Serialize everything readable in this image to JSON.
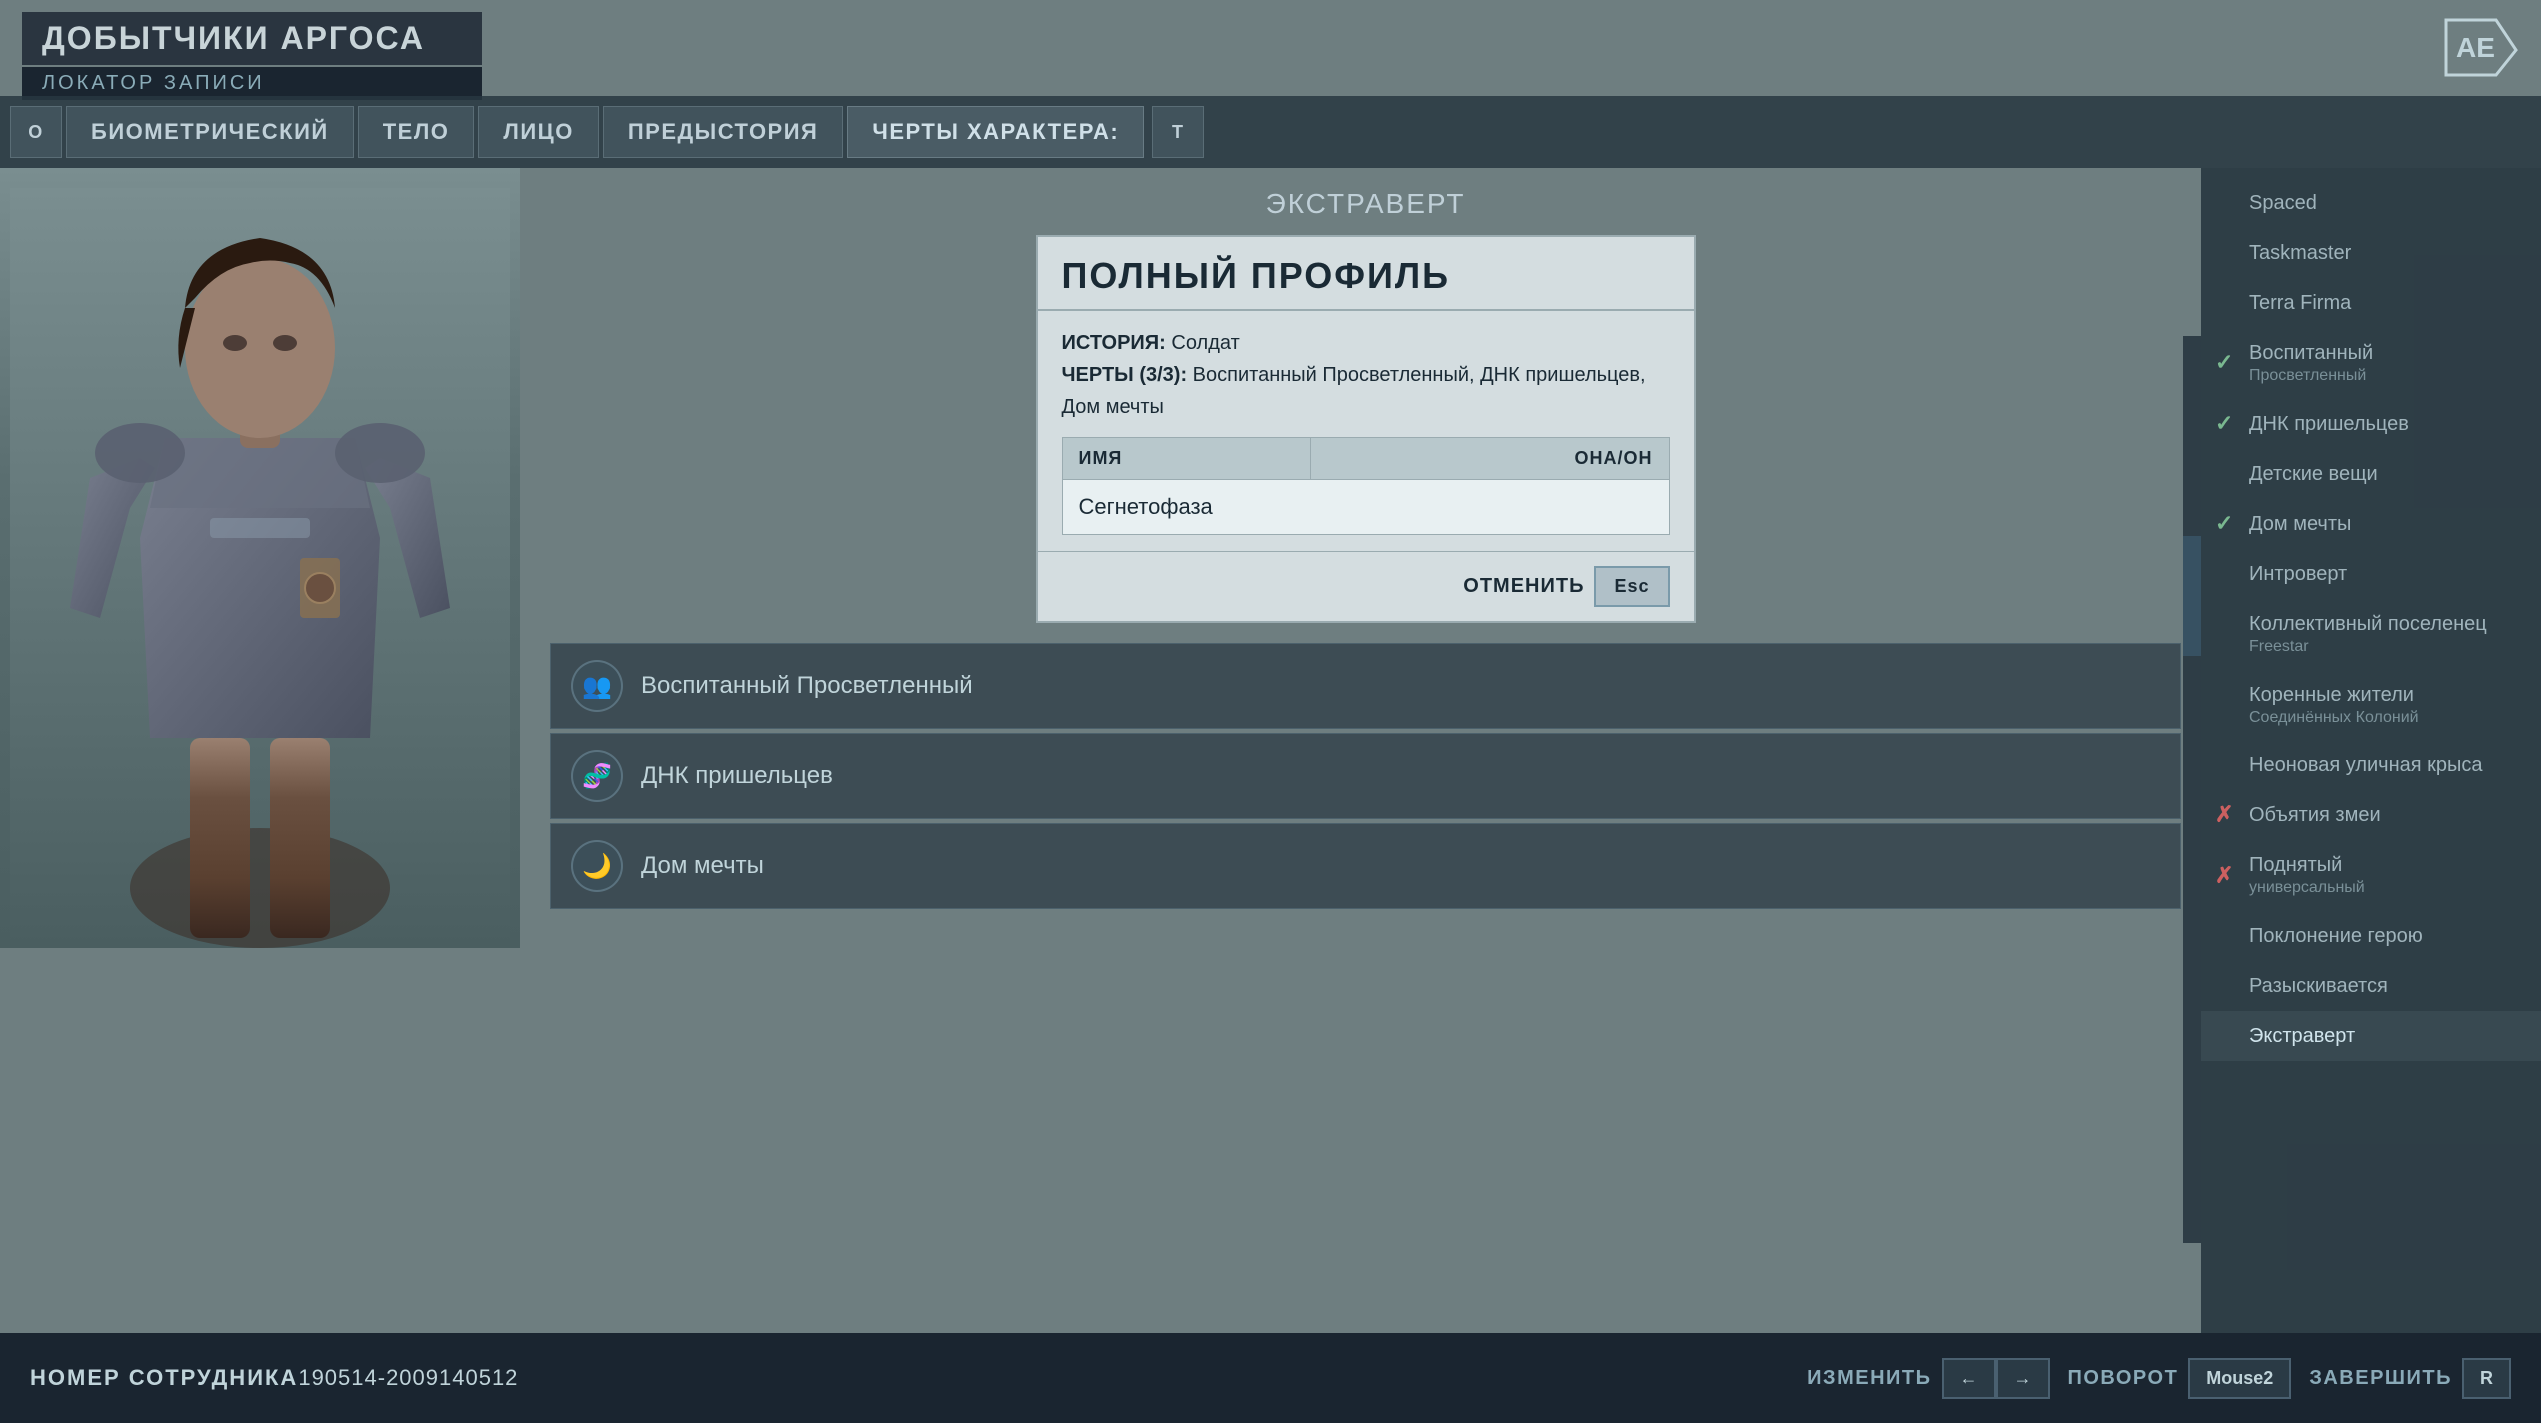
{
  "header": {
    "game_title": "ДОБЫТЧИКИ АРГОСА",
    "subtitle": "ЛОКАТОР ЗАПИСИ",
    "logo_symbol": "AE"
  },
  "nav": {
    "btn_o": "O",
    "btn_biometric": "БИОМЕТРИЧЕСКИЙ",
    "btn_body": "ТЕЛО",
    "btn_face": "ЛИЦО",
    "btn_background": "ПРЕДЫСТОРИЯ",
    "btn_traits": "ЧЕРТЫ ХАРАКТЕРА:",
    "btn_t": "T"
  },
  "character_label": "Экстраверт",
  "profile_modal": {
    "title": "ПОЛНЫЙ ПРОФИЛЬ",
    "history_label": "ИСТОРИЯ:",
    "history_value": "Солдат",
    "traits_label": "ЧЕРТЫ (3/3):",
    "traits_value": "Воспитанный Просветленный, ДНК пришельцев, Дом мечты",
    "table": {
      "col_name": "ИМЯ",
      "col_pronoun": "ОНА/ОН",
      "name_value": "Сегнетофаза"
    },
    "cancel_label": "ОТМЕНИТЬ",
    "esc_label": "Esc"
  },
  "traits_list": [
    {
      "icon": "👥",
      "label": "Воспитанный Просветленный"
    },
    {
      "icon": "🧬",
      "label": "ДНК пришельцев"
    },
    {
      "icon": "🌙",
      "label": "Дом мечты"
    }
  ],
  "right_panel": {
    "items": [
      {
        "label": "Spaced",
        "sub": "",
        "state": "none"
      },
      {
        "label": "Taskmaster",
        "sub": "",
        "state": "none"
      },
      {
        "label": "Terra Firma",
        "sub": "",
        "state": "none"
      },
      {
        "label": "Воспитанный",
        "sub": "Просветленный",
        "state": "checked-green"
      },
      {
        "label": "ДНК пришельцев",
        "sub": "",
        "state": "checked-green"
      },
      {
        "label": "Детские вещи",
        "sub": "",
        "state": "none"
      },
      {
        "label": "Дом мечты",
        "sub": "",
        "state": "checked-green"
      },
      {
        "label": "Интроверт",
        "sub": "",
        "state": "none"
      },
      {
        "label": "Коллективный поселенец",
        "sub": "Freestar",
        "state": "none"
      },
      {
        "label": "Коренные жители",
        "sub": "Соединённых Колоний",
        "state": "none"
      },
      {
        "label": "Неоновая уличная крыса",
        "sub": "",
        "state": "none"
      },
      {
        "label": "Объятия змеи",
        "sub": "",
        "state": "checked-x"
      },
      {
        "label": "Поднятый",
        "sub": "универсальный",
        "state": "checked-x"
      },
      {
        "label": "Поклонение герою",
        "sub": "",
        "state": "none"
      },
      {
        "label": "Разыскивается",
        "sub": "",
        "state": "none"
      },
      {
        "label": "Экстраверт",
        "sub": "",
        "state": "selected"
      }
    ]
  },
  "bottom_bar": {
    "employee_label": "НОМЕР СОТРУДНИКА",
    "employee_value": "190514-2009140512",
    "change_label": "ИЗМЕНИТЬ",
    "left_arrow": "←",
    "right_arrow": "→",
    "rotation_label": "ПОВОРОТ",
    "mouse_label": "Mouse2",
    "finish_label": "ЗАВЕРШИТЬ",
    "r_label": "R"
  }
}
